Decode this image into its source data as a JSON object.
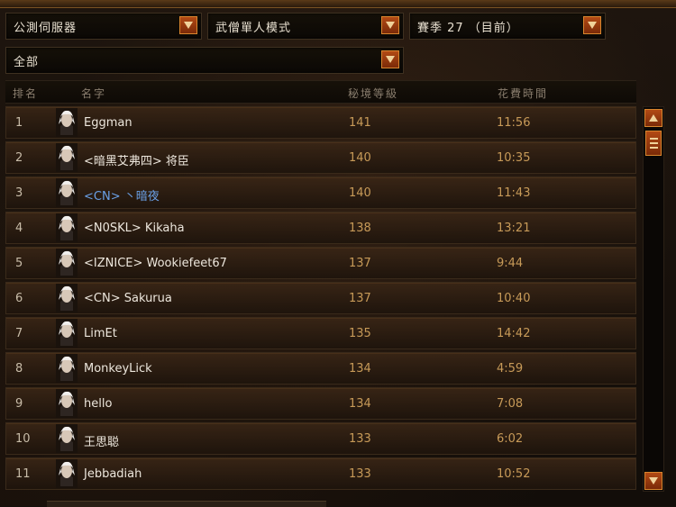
{
  "filters": {
    "server": "公測伺服器",
    "mode": "武僧單人模式",
    "season": "賽季 27 （目前）",
    "class_filter": "全部"
  },
  "columns": {
    "rank": "排名",
    "name": "名字",
    "level": "秘境等級",
    "time": "花費時間"
  },
  "rows": [
    {
      "rank": "1",
      "name": "Eggman",
      "level": "141",
      "time": "11:56"
    },
    {
      "rank": "2",
      "name": "<暗黑艾弗四> 将臣",
      "level": "140",
      "time": "10:35"
    },
    {
      "rank": "3",
      "name": "<CN> 丶暗夜",
      "level": "140",
      "time": "11:43"
    },
    {
      "rank": "4",
      "name": "<N0SKL> Kikaha",
      "level": "138",
      "time": "13:21"
    },
    {
      "rank": "5",
      "name": "<IZNICE> Wookiefeet67",
      "level": "137",
      "time": "9:44"
    },
    {
      "rank": "6",
      "name": "<CN> Sakurua",
      "level": "137",
      "time": "10:40"
    },
    {
      "rank": "7",
      "name": "LimEt",
      "level": "135",
      "time": "14:42"
    },
    {
      "rank": "8",
      "name": "MonkeyLick",
      "level": "134",
      "time": "4:59"
    },
    {
      "rank": "9",
      "name": "hello",
      "level": "134",
      "time": "7:08"
    },
    {
      "rank": "10",
      "name": "王思聪",
      "level": "133",
      "time": "6:02"
    },
    {
      "rank": "11",
      "name": "Jebbadiah",
      "level": "133",
      "time": "10:52"
    }
  ],
  "icons": {
    "dropdown_arrow": "chevron-down-icon",
    "scroll_up": "arrow-up-icon",
    "scroll_down": "arrow-down-icon",
    "scroll_thumb": "scroll-thumb-icon",
    "avatar": "monk-portrait-icon"
  },
  "colors": {
    "accent": "#b24a14",
    "accent_border": "#d8862e",
    "clan_highlight": "#6aa0e6",
    "value_text": "#c79a58"
  }
}
